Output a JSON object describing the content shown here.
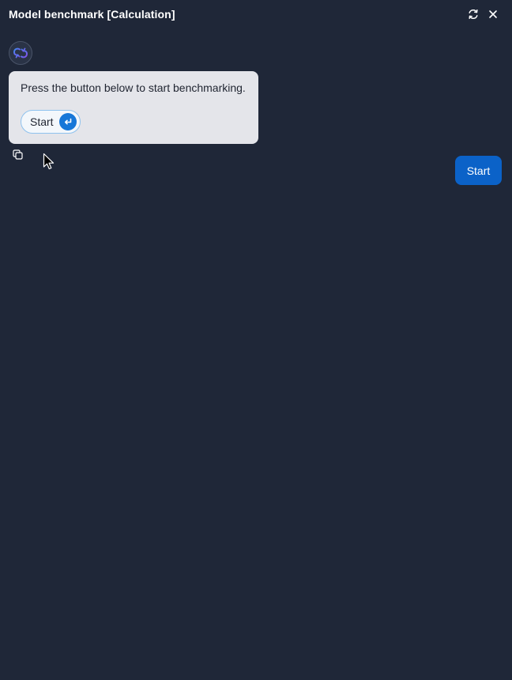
{
  "window": {
    "title": "Model benchmark [Calculation]",
    "icons": {
      "refresh": "refresh-icon",
      "close": "close-icon"
    }
  },
  "assistant": {
    "avatar_icon": "bot-logo-icon",
    "message": "Press the button below to start benchmarking.",
    "start_button_label": "Start",
    "start_button_icon": "enter-icon",
    "copy_icon": "copy-icon"
  },
  "user": {
    "message": "Start"
  },
  "colors": {
    "background": "#1f2738",
    "bubble": "#e4e5ea",
    "accent": "#1677d8",
    "user_bubble": "#0b62c8"
  }
}
